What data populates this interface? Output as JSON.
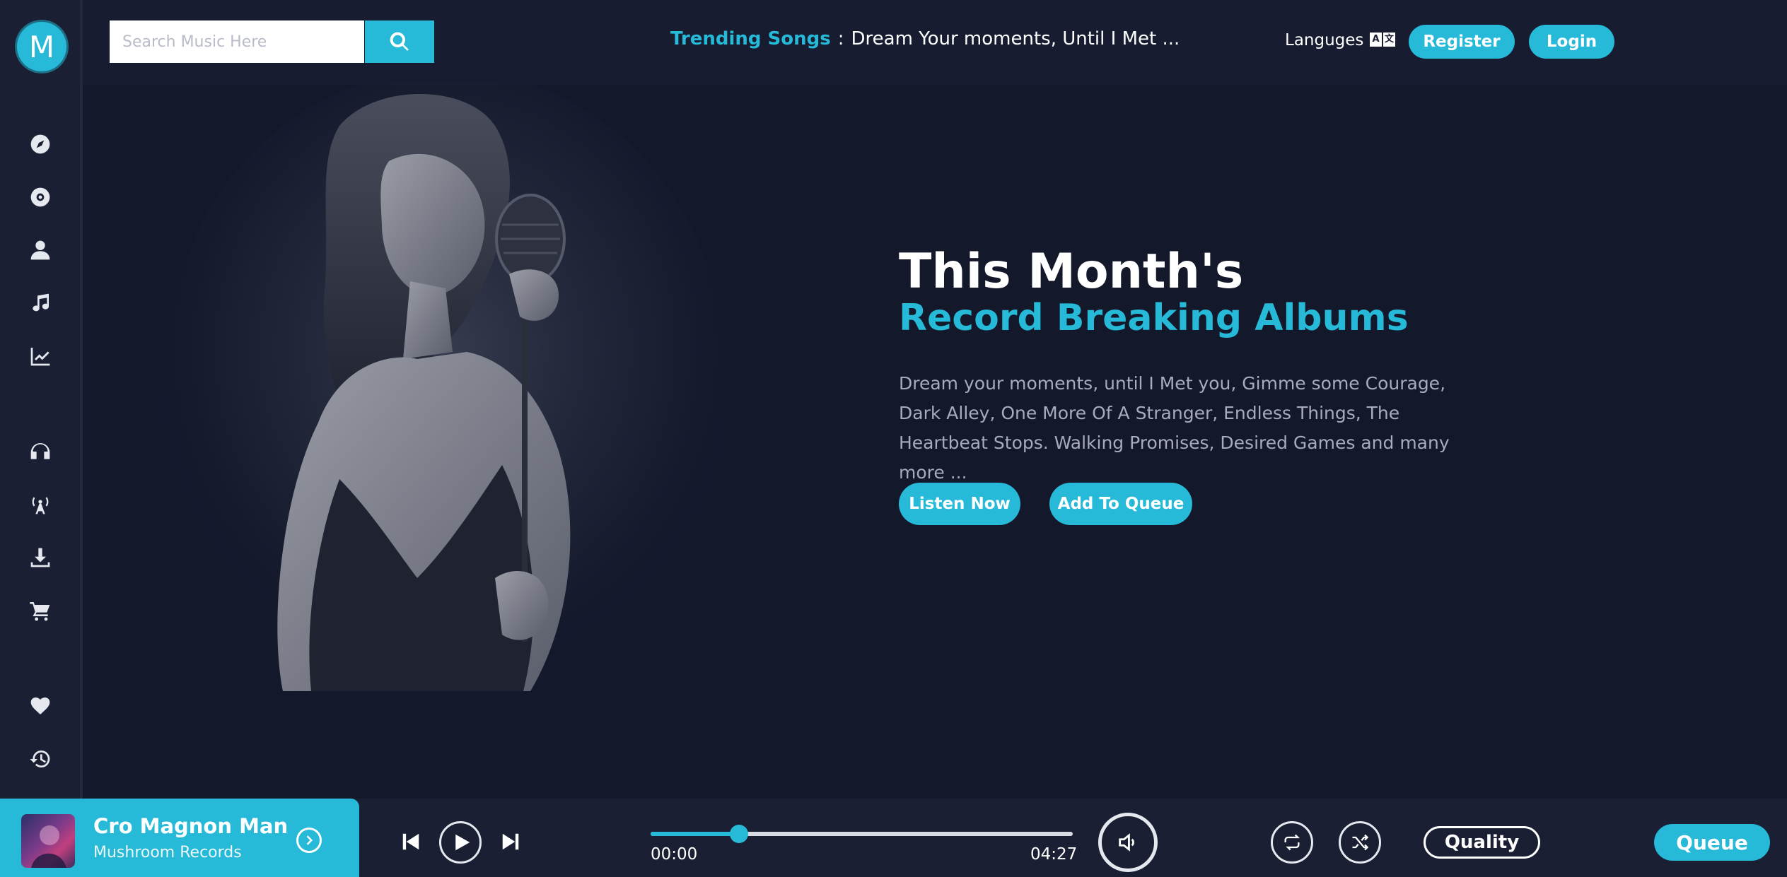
{
  "logo": {
    "letter": "M"
  },
  "search": {
    "placeholder": "Search Music Here"
  },
  "header": {
    "trending_label": "Trending Songs",
    "trending_separator": ":",
    "trending_songs": "Dream Your moments, Until I Met ...",
    "languages_label": "Languges",
    "register_label": "Register",
    "login_label": "Login"
  },
  "sidebar": {
    "items": [
      {
        "icon": "compass-icon"
      },
      {
        "icon": "disc-icon"
      },
      {
        "icon": "user-icon"
      },
      {
        "icon": "music-note-icon"
      },
      {
        "icon": "chart-icon"
      },
      {
        "icon": "headphones-icon"
      },
      {
        "icon": "radio-tower-icon"
      },
      {
        "icon": "download-icon"
      },
      {
        "icon": "cart-icon"
      },
      {
        "icon": "heart-icon"
      },
      {
        "icon": "history-icon"
      }
    ]
  },
  "hero": {
    "title": "This Month's",
    "subtitle": "Record Breaking Albums",
    "description": "Dream your moments, until I Met you, Gimme some Courage, Dark Alley, One More Of A Stranger, Endless Things, The Heartbeat Stops. Walking Promises, Desired Games and many more ...",
    "listen_label": "Listen Now",
    "queue_label": "Add To Queue"
  },
  "player": {
    "track_title": "Cro Magnon Man",
    "track_artist": "Mushroom Records",
    "current_time": "00:00",
    "total_time": "04:27",
    "progress_fraction": 0.21,
    "quality_label": "Quality",
    "queue_label": "Queue"
  },
  "colors": {
    "accent": "#26b9d8",
    "background": "#14182b",
    "sidebar": "#1a1f33"
  }
}
